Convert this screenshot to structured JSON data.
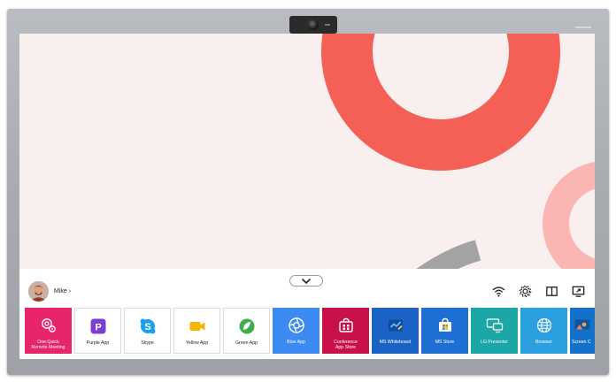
{
  "user": {
    "name": "Mike",
    "chevron": "›",
    "avatar_icon": "user-photo"
  },
  "status_icons": [
    "wifi-icon",
    "settings-gear-icon",
    "split-screen-icon",
    "screen-share-icon"
  ],
  "apps": [
    {
      "label": "One:Quick\nRemote Meeting",
      "bg": "#e8256c",
      "icon": "remote-meeting-icon"
    },
    {
      "label": "Purple App",
      "bg": "#ffffff",
      "icon": "purple-p-icon",
      "accent": "#7a3fd0"
    },
    {
      "label": "Skype",
      "bg": "#ffffff",
      "icon": "skype-icon",
      "accent": "#1a9ff0"
    },
    {
      "label": "Yellow App",
      "bg": "#ffffff",
      "icon": "yellow-camera-icon",
      "accent": "#f4b400"
    },
    {
      "label": "Green App",
      "bg": "#ffffff",
      "icon": "green-leaf-icon",
      "accent": "#3fae49"
    },
    {
      "label": "Blue App",
      "bg": "#3d8bf2",
      "icon": "blue-aperture-icon"
    },
    {
      "label": "Conference\nApp Store",
      "bg": "#c8104a",
      "icon": "app-store-bag-icon"
    },
    {
      "label": "MS Whiteboard",
      "bg": "#1a62c4",
      "icon": "whiteboard-icon"
    },
    {
      "label": "MS Store",
      "bg": "#1e6fd4",
      "icon": "store-bag-icon"
    },
    {
      "label": "LG Presenter",
      "bg": "#1ba7a8",
      "icon": "presenter-icon"
    },
    {
      "label": "Browser",
      "bg": "#2a9fe0",
      "icon": "globe-icon"
    },
    {
      "label": "Screen C",
      "bg": "#1471c9",
      "icon": "screen-cast-icon"
    }
  ],
  "colors": {
    "wallpaper": "#f8efee",
    "ring_main": "#f45f56",
    "ring_side": "#fbb6b3",
    "arc_gray": "#a3a3a3"
  }
}
